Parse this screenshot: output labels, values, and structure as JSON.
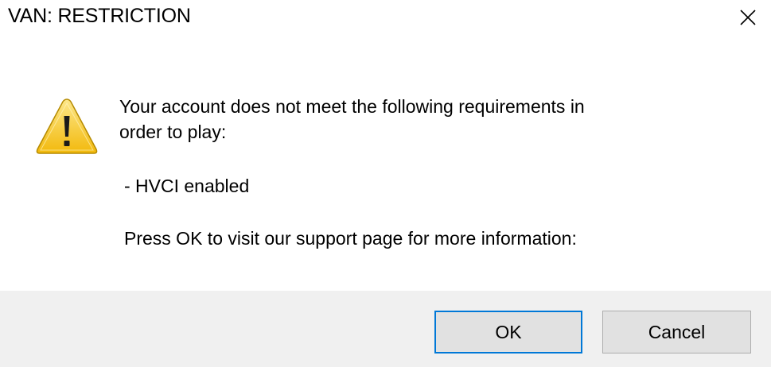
{
  "window": {
    "title": "VAN: RESTRICTION",
    "close_icon": "close-icon"
  },
  "message": {
    "icon": "warning-icon",
    "line1": "Your account does not meet the following requirements in",
    "line2": "order to play:",
    "requirement": "- HVCI enabled",
    "instruction": "Press OK to visit our support page for more information:"
  },
  "buttons": {
    "ok_label": "OK",
    "cancel_label": "Cancel"
  },
  "colors": {
    "accent": "#0078d7",
    "footer_bg": "#f0f0f0",
    "button_bg": "#e1e1e1",
    "warning_fill": "#f5c518"
  }
}
